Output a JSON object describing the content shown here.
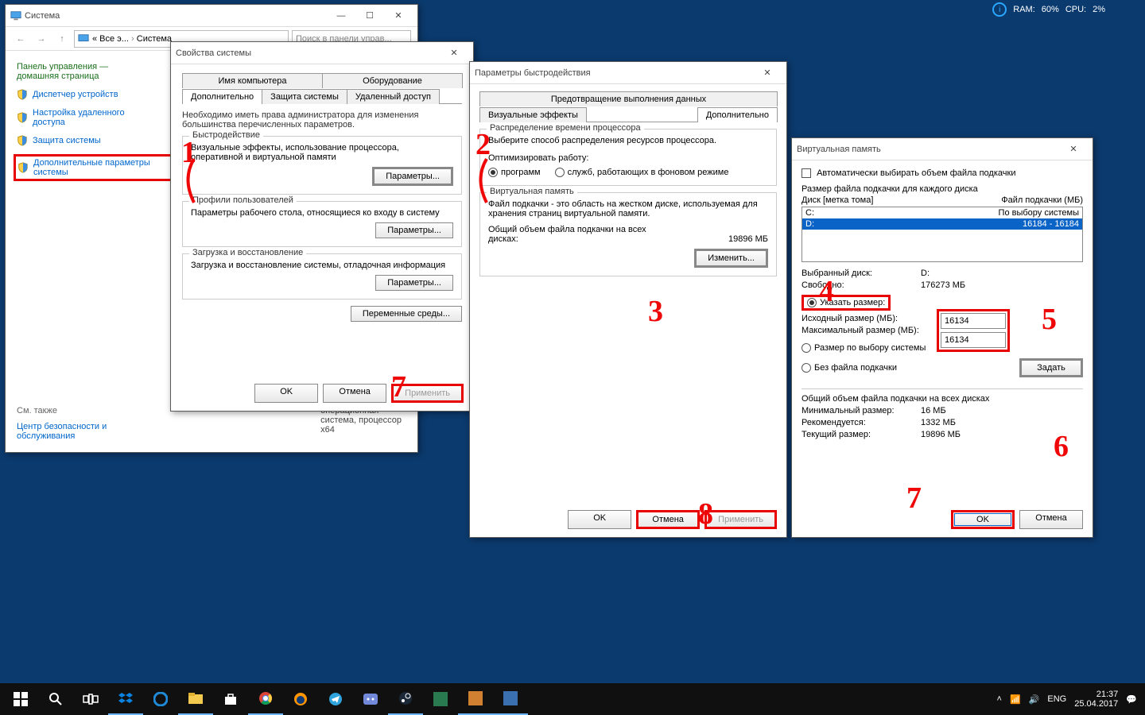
{
  "statbar": {
    "ram_label": "RAM:",
    "ram_val": "60%",
    "cpu_label": "CPU:",
    "cpu_val": "2%"
  },
  "sysA": {
    "title": "Система",
    "breadcrumb_a": "« Все э...",
    "breadcrumb_b": "Система",
    "search_ph": "Поиск в панели управ...",
    "cp_home_l1": "Панель управления —",
    "cp_home_l2": "домашняя страница",
    "links": {
      "devmgr": "Диспетчер устройств",
      "remote_l1": "Настройка удаленного",
      "remote_l2": "доступа",
      "sysprotect": "Защита системы",
      "adv_l1": "Дополнительные параметры",
      "adv_l2": "системы"
    },
    "seealso": "См. также",
    "sec_l1": "Центр безопасности и",
    "sec_l2": "обслуживания",
    "os_l1": "операционная",
    "os_l2": "система, процессор",
    "os_l3": "x64"
  },
  "sysB": {
    "title": "Свойства системы",
    "tabs": {
      "t1": "Имя компьютера",
      "t2": "Оборудование",
      "t3": "Дополнительно",
      "t4": "Защита системы",
      "t5": "Удаленный доступ"
    },
    "note": "Необходимо иметь права администратора для изменения большинства перечисленных параметров.",
    "perf_legend": "Быстродействие",
    "perf_txt": "Визуальные эффекты, использование процессора, оперативной и виртуальной памяти",
    "params_btn": "Параметры...",
    "profiles_legend": "Профили пользователей",
    "profiles_txt": "Параметры рабочего стола, относящиеся ко входу в систему",
    "boot_legend": "Загрузка и восстановление",
    "boot_txt": "Загрузка и восстановление системы, отладочная информация",
    "envvars": "Переменные среды...",
    "ok": "OK",
    "cancel": "Отмена",
    "apply": "Применить"
  },
  "sysC": {
    "title": "Параметры быстродействия",
    "tabs": {
      "t1": "Визуальные эффекты",
      "t2": "Предотвращение выполнения данных",
      "t3": "Дополнительно"
    },
    "sched_legend": "Распределение времени процессора",
    "sched_txt": "Выберите способ распределения ресурсов процессора.",
    "opt_label": "Оптимизировать работу:",
    "opt_programs": "программ",
    "opt_services": "служб, работающих в фоновом режиме",
    "vm_legend": "Виртуальная память",
    "vm_txt": "Файл подкачки - это область на жестком диске, используемая для хранения страниц виртуальной памяти.",
    "vm_total_l1": "Общий объем файла подкачки на всех",
    "vm_total_l2": "дисках:",
    "vm_total_val": "19896 МБ",
    "change": "Изменить...",
    "ok": "OK",
    "cancel": "Отмена",
    "apply": "Применить"
  },
  "sysD": {
    "title": "Виртуальная память",
    "auto_chk": "Автоматически выбирать объем файла подкачки",
    "size_title": "Размер файла подкачки для каждого диска",
    "col_drive": "Диск [метка тома]",
    "col_pf": "Файл подкачки (МБ)",
    "drives": [
      {
        "d": "C:",
        "v": "По выбору системы"
      },
      {
        "d": "D:",
        "v": "16184 - 16184"
      }
    ],
    "sel_drive_l": "Выбранный диск:",
    "sel_drive_v": "D:",
    "free_l": "Свободно:",
    "free_v": "176273 МБ",
    "custom": "Указать размер:",
    "init_l": "Исходный размер (МБ):",
    "init_v": "16134",
    "max_l": "Максимальный размер (МБ):",
    "max_v": "16134",
    "sys_managed": "Размер по выбору системы",
    "no_pf": "Без файла подкачки",
    "set": "Задать",
    "total_title": "Общий объем файла подкачки на всех дисках",
    "min_l": "Минимальный размер:",
    "min_v": "16 МБ",
    "rec_l": "Рекомендуется:",
    "rec_v": "1332 МБ",
    "cur_l": "Текущий размер:",
    "cur_v": "19896 МБ",
    "ok": "OK",
    "cancel": "Отмена"
  },
  "taskbar": {
    "lang": "ENG",
    "time": "21:37",
    "date": "25.04.2017"
  },
  "anno": {
    "a1": "1",
    "a2": "2",
    "a3": "3",
    "a4": "4",
    "a5": "5",
    "a6": "6",
    "a7": "7",
    "a7b": "7",
    "a8": "8"
  }
}
